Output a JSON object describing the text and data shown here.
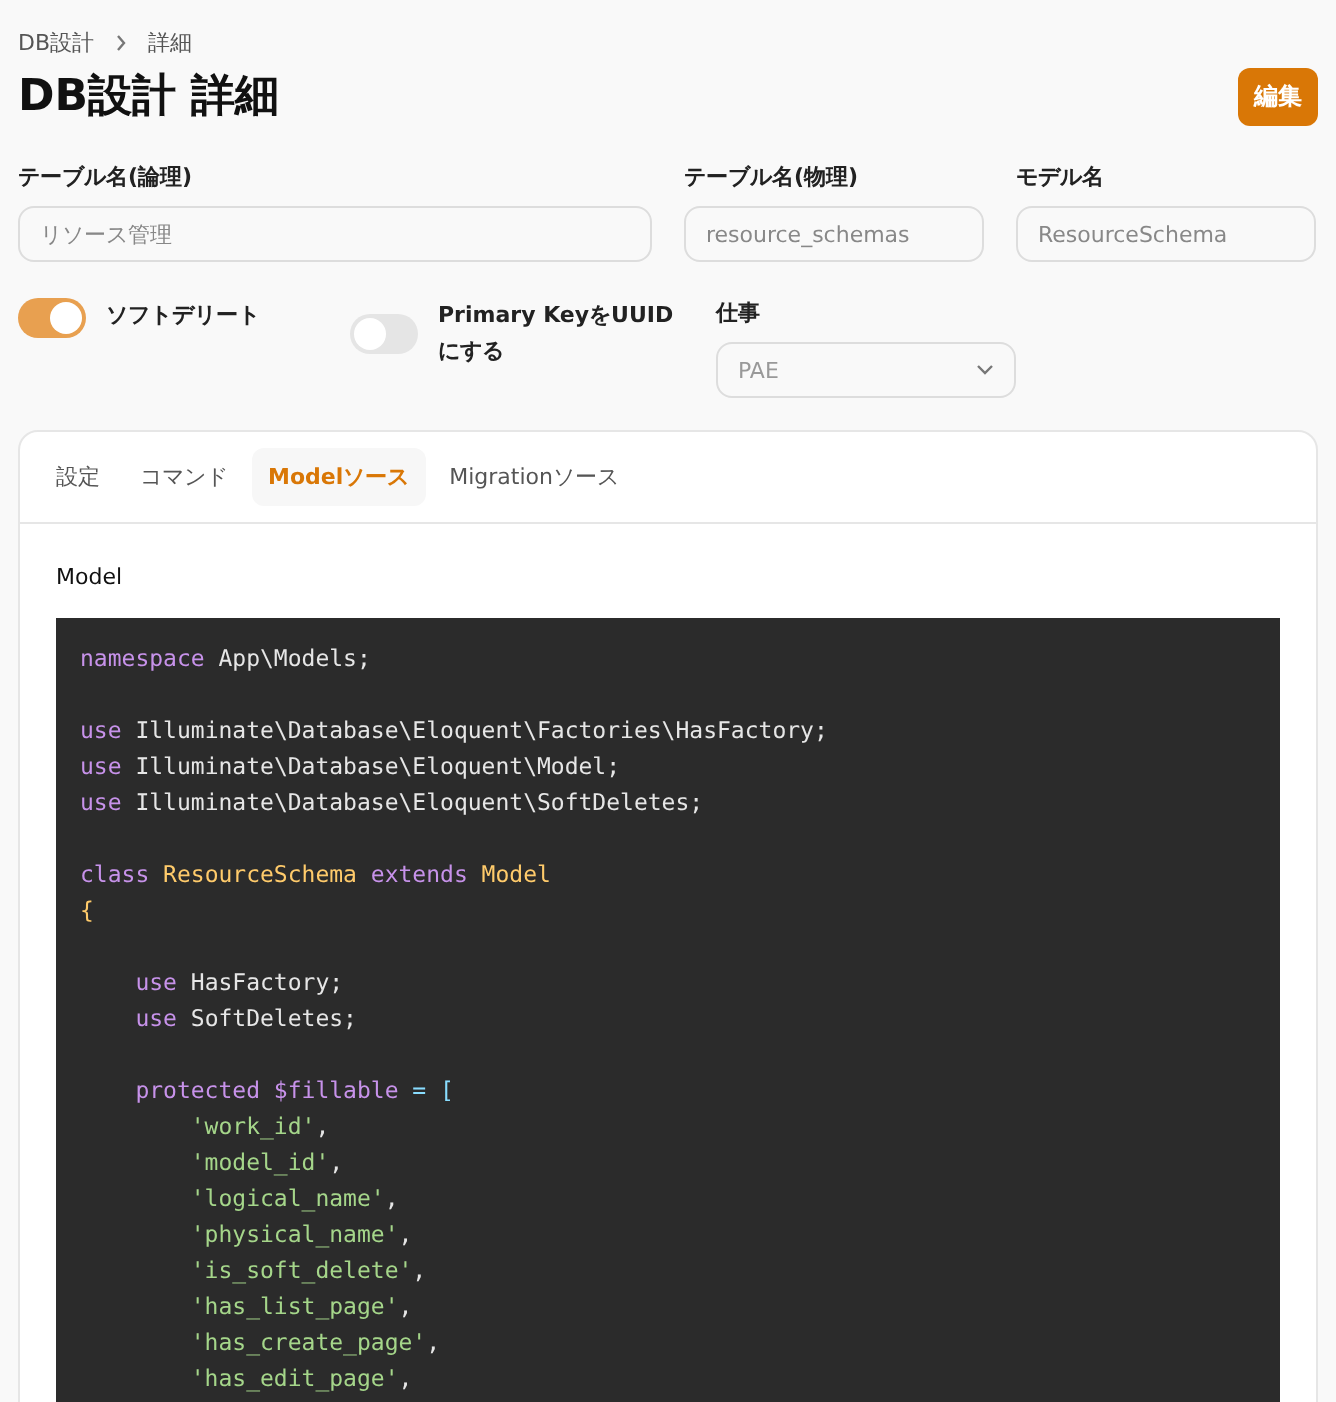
{
  "breadcrumb": [
    "DB設計",
    "詳細"
  ],
  "title": "DB設計 詳細",
  "edit_button": "編集",
  "fields": [
    {
      "label": "テーブル名(論理)",
      "value": "リソース管理"
    },
    {
      "label": "テーブル名(物理)",
      "value": "resource_schemas"
    },
    {
      "label": "モデル名",
      "value": "ResourceSchema"
    }
  ],
  "toggles": [
    {
      "label": "ソフトデリート",
      "on": true
    },
    {
      "label": "Primary KeyをUUIDにする",
      "on": false
    }
  ],
  "work_select": {
    "label": "仕事",
    "value": "PAE"
  },
  "tabs": [
    {
      "label": "設定",
      "selected": false
    },
    {
      "label": "コマンド",
      "selected": false
    },
    {
      "label": "Modelソース",
      "selected": true
    },
    {
      "label": "Migrationソース",
      "selected": false
    }
  ],
  "section_label": "Model",
  "code_lines": [
    {
      "blank_before": false,
      "tokens": [
        {
          "kind": "kw",
          "text": "namespace"
        },
        {
          "kind": "plain",
          "text": " App\\Models;"
        }
      ]
    },
    {
      "blank_before": true,
      "tokens": [
        {
          "kind": "kw",
          "text": "use"
        },
        {
          "kind": "plain",
          "text": " Illuminate\\Database\\Eloquent\\Factories\\HasFactory;"
        }
      ]
    },
    {
      "blank_before": false,
      "tokens": [
        {
          "kind": "kw",
          "text": "use"
        },
        {
          "kind": "plain",
          "text": " Illuminate\\Database\\Eloquent\\Model;"
        }
      ]
    },
    {
      "blank_before": false,
      "tokens": [
        {
          "kind": "kw",
          "text": "use"
        },
        {
          "kind": "plain",
          "text": " Illuminate\\Database\\Eloquent\\SoftDeletes;"
        }
      ]
    },
    {
      "blank_before": true,
      "tokens": [
        {
          "kind": "kw",
          "text": "class"
        },
        {
          "kind": "cls",
          "text": " ResourceSchema "
        },
        {
          "kind": "kw",
          "text": "extends"
        },
        {
          "kind": "cls",
          "text": " Model"
        }
      ]
    },
    {
      "blank_before": false,
      "tokens": [
        {
          "kind": "cls",
          "text": "{"
        }
      ]
    },
    {
      "blank_before": true,
      "tokens": [
        {
          "kind": "kw",
          "text": "    use"
        },
        {
          "kind": "plain",
          "text": " HasFactory;"
        }
      ]
    },
    {
      "blank_before": false,
      "tokens": [
        {
          "kind": "kw",
          "text": "    use"
        },
        {
          "kind": "plain",
          "text": " SoftDeletes;"
        }
      ]
    },
    {
      "blank_before": true,
      "tokens": [
        {
          "kind": "kw",
          "text": "    protected $fillable"
        },
        {
          "kind": "op",
          "text": " = ["
        }
      ]
    },
    {
      "blank_before": false,
      "tokens": [
        {
          "kind": "str",
          "text": "        'work_id'"
        },
        {
          "kind": "plain",
          "text": ","
        }
      ]
    },
    {
      "blank_before": false,
      "tokens": [
        {
          "kind": "str",
          "text": "        'model_id'"
        },
        {
          "kind": "plain",
          "text": ","
        }
      ]
    },
    {
      "blank_before": false,
      "tokens": [
        {
          "kind": "str",
          "text": "        'logical_name'"
        },
        {
          "kind": "plain",
          "text": ","
        }
      ]
    },
    {
      "blank_before": false,
      "tokens": [
        {
          "kind": "str",
          "text": "        'physical_name'"
        },
        {
          "kind": "plain",
          "text": ","
        }
      ]
    },
    {
      "blank_before": false,
      "tokens": [
        {
          "kind": "str",
          "text": "        'is_soft_delete'"
        },
        {
          "kind": "plain",
          "text": ","
        }
      ]
    },
    {
      "blank_before": false,
      "tokens": [
        {
          "kind": "str",
          "text": "        'has_list_page'"
        },
        {
          "kind": "plain",
          "text": ","
        }
      ]
    },
    {
      "blank_before": false,
      "tokens": [
        {
          "kind": "str",
          "text": "        'has_create_page'"
        },
        {
          "kind": "plain",
          "text": ","
        }
      ]
    },
    {
      "blank_before": false,
      "tokens": [
        {
          "kind": "str",
          "text": "        'has_edit_page'"
        },
        {
          "kind": "plain",
          "text": ","
        }
      ]
    }
  ]
}
